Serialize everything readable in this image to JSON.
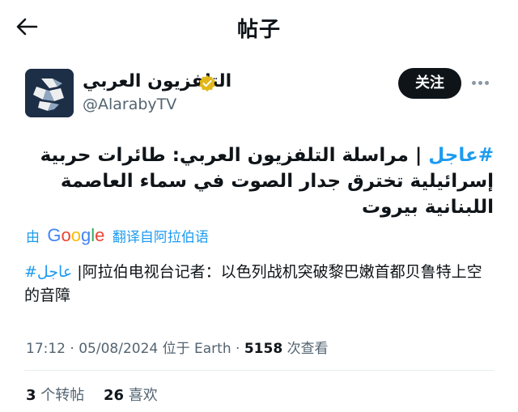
{
  "header": {
    "back_icon": "arrow-left-icon",
    "title": "帖子"
  },
  "author": {
    "name": "التلفزيون العربي",
    "handle": "@AlarabyTV",
    "verified_icon": "verified-badge-icon",
    "verified_color": "#e2b719",
    "avatar_bg": "#1d2f47",
    "follow_label": "关注",
    "more_icon": "more-horizontal-icon"
  },
  "tweet": {
    "hashtag": "#عاجل",
    "line_text": " | مراسلة التلفزيون العربي: طائرات حربية إسرائيلية تخترق جدار الصوت في سماء العاصمة اللبنانية بيروت",
    "hashtag_color": "#1d9bf0"
  },
  "translation": {
    "by_label": "由",
    "provider": "Google",
    "link_label": "翻译自阿拉伯语",
    "hashtag": "#عاجل",
    "text": " |阿拉伯电视台记者：以色列战机突破黎巴嫩首都贝鲁特上空的音障"
  },
  "meta": {
    "time": "17:12",
    "date": "05/08/2024",
    "location_prefix": "位于",
    "location": "Earth",
    "views": "5158",
    "views_label": "次查看"
  },
  "stats": {
    "retweets": "3",
    "retweets_label": "个转帖",
    "likes": "26",
    "likes_label": "喜欢"
  }
}
